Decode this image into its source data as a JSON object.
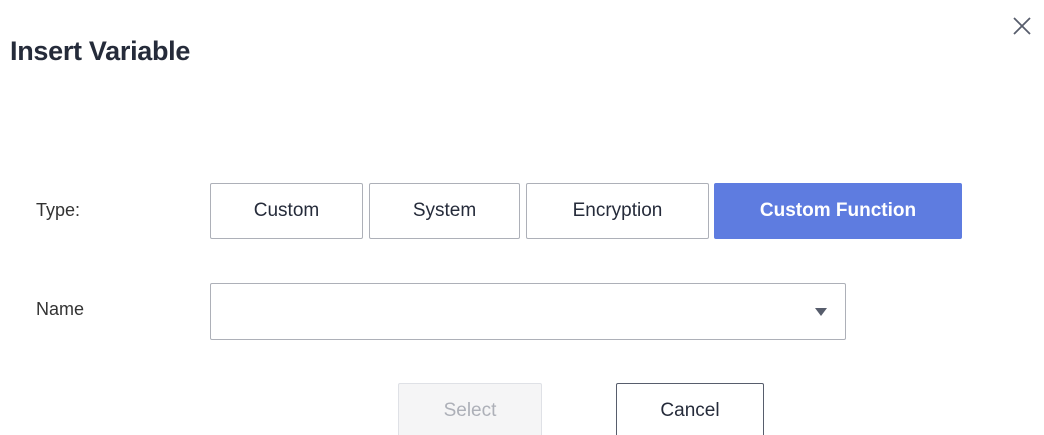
{
  "dialog": {
    "title": "Insert Variable",
    "close_icon": "close-icon"
  },
  "form": {
    "type_label": "Type:",
    "name_label": "Name",
    "type_options": [
      {
        "label": "Custom",
        "selected": false
      },
      {
        "label": "System",
        "selected": false
      },
      {
        "label": "Encryption",
        "selected": false
      },
      {
        "label": "Custom Function",
        "selected": true
      }
    ],
    "name_select": {
      "value": "",
      "caret_icon": "caret-down-icon"
    }
  },
  "footer": {
    "select_label": "Select",
    "select_disabled": true,
    "cancel_label": "Cancel"
  },
  "colors": {
    "accent": "#5e7ce0",
    "border": "#adb0b8",
    "text": "#252b3a",
    "disabled_text": "#adb0b8"
  }
}
